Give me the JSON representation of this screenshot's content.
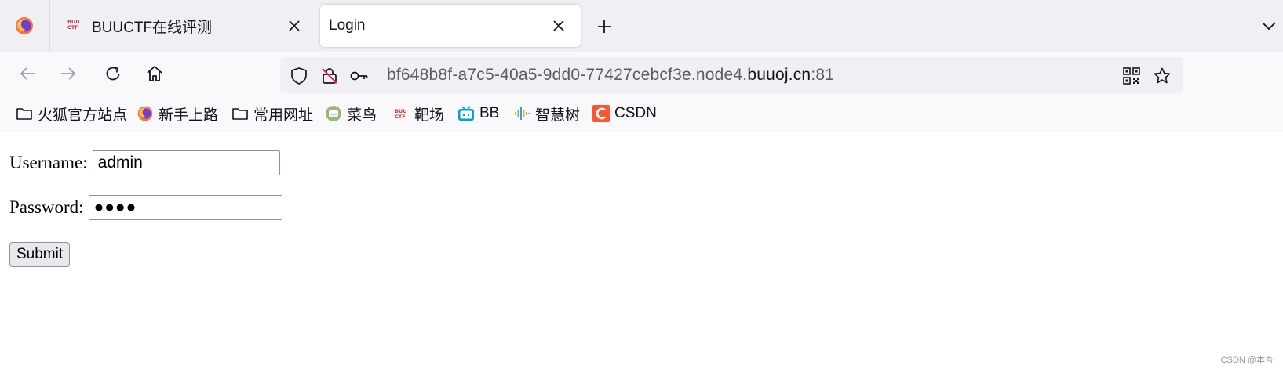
{
  "browser": {
    "tabs": [
      {
        "title": "BUUCTF在线评测",
        "favicon": "buuctf-icon",
        "active": false
      },
      {
        "title": "Login",
        "active": true
      }
    ],
    "url": {
      "prefix": "bf648b8f-a7c5-40a5-9dd0-77427cebcf3e.node4.",
      "host": "buuoj.cn",
      "port": ":81"
    },
    "bookmarks": [
      {
        "label": "火狐官方站点",
        "icon": "folder-icon"
      },
      {
        "label": "新手上路",
        "icon": "firefox-icon"
      },
      {
        "label": "常用网址",
        "icon": "folder-icon"
      },
      {
        "label": "菜鸟",
        "icon": "runoob-icon"
      },
      {
        "label": "靶场",
        "icon": "buuctf-icon"
      },
      {
        "label": "BB",
        "icon": "bilibili-icon"
      },
      {
        "label": "智慧树",
        "icon": "zhihuishu-icon"
      },
      {
        "label": "CSDN",
        "icon": "csdn-icon"
      }
    ],
    "colors": {
      "accent_red": "#e0333a",
      "csdn_orange": "#fc5531",
      "bilibili_blue": "#00a1d6"
    }
  },
  "form": {
    "username_label": "Username:",
    "username_value": "admin",
    "password_label": "Password:",
    "password_value": "●●●●",
    "submit_label": "Submit"
  },
  "watermark": "CSDN @本吾"
}
